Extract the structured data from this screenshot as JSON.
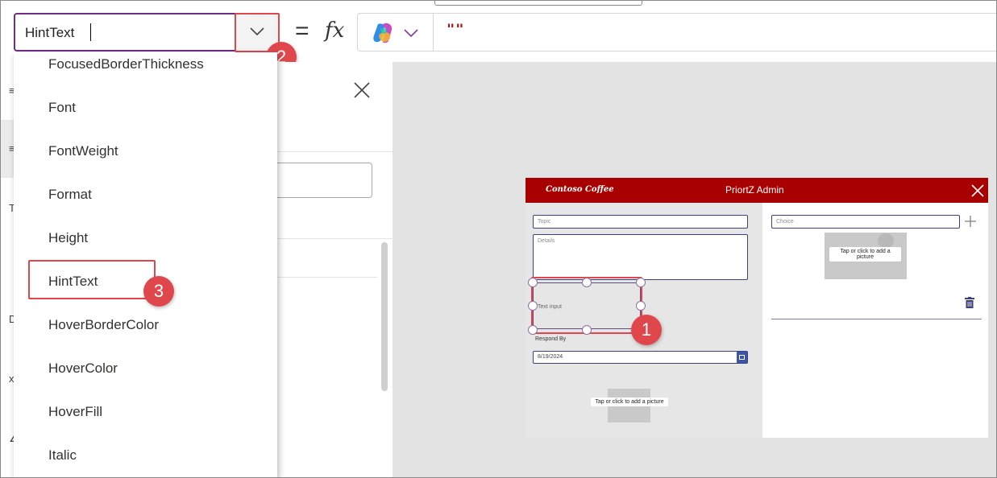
{
  "formula_bar": {
    "property_value": "HintText",
    "equals": "=",
    "fx": "fx",
    "formula": "\"\""
  },
  "property_dropdown": {
    "items": [
      "FocusedBorderThickness",
      "Font",
      "FontWeight",
      "Format",
      "Height",
      "HintText",
      "HoverBorderColor",
      "HoverColor",
      "HoverFill",
      "Italic"
    ],
    "highlighted": "HintText"
  },
  "callouts": [
    "1",
    "2",
    "3"
  ],
  "app": {
    "brand": "Contoso Coffee",
    "title": "PriortZ Admin",
    "topic_placeholder": "Topic",
    "details_placeholder": "Details",
    "text_input_placeholder": "Text input",
    "respond_by_label": "Respond By",
    "respond_by_date": "8/19/2024",
    "image_hint": "Tap or click to add a picture",
    "choice_placeholder": "Choice",
    "image_hint_right": "Tap or click to add a picture"
  },
  "colors": {
    "accent_purple": "#6f2d86",
    "callout_red": "#e0474c",
    "header_red": "#a80000",
    "formula_red": "#a31515"
  },
  "icons": [
    "chevron-down-icon",
    "copilot-icon",
    "close-icon",
    "plus-icon",
    "trash-icon",
    "calendar-icon",
    "image-placeholder-icon"
  ]
}
